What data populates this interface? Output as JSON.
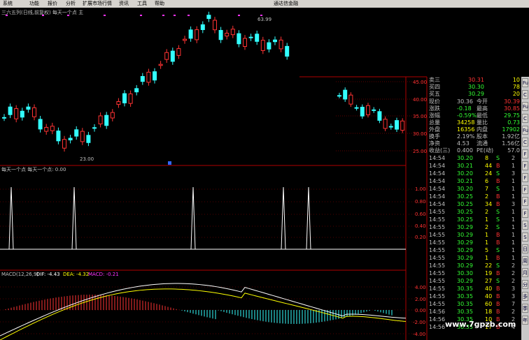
{
  "menu": {
    "items": [
      "系统",
      "功能",
      "报价",
      "分析",
      "扩展市场行情",
      "资讯",
      "工具",
      "帮助"
    ],
    "brand": "通达信金融"
  },
  "main_chart": {
    "title": "三六五列(日线,前复权) 每天一个点 主",
    "high_label": "63.99",
    "low_label": "23.00",
    "price_ticks": [
      "45.00",
      "40.00",
      "35.00",
      "30.00",
      "25.00"
    ]
  },
  "indicator1": {
    "title": "每天一个点  每天一个点: 0.00",
    "ticks": [
      "1.00",
      "0.80",
      "0.60",
      "0.40",
      "0.20"
    ]
  },
  "macd": {
    "label": "MACD(12,26,9)",
    "dif": "DIF: -4.43",
    "dea": "DEA: -4.32",
    "macd": "MACD: -0.21",
    "ticks": [
      "4.00",
      "2.00",
      "0.00",
      "-2.00",
      "-4.00"
    ]
  },
  "quote": {
    "rows": [
      {
        "label": "卖三",
        "value": "30.31",
        "vol": "10"
      },
      {
        "label": "买四",
        "value": "30.30",
        "vol": "78"
      },
      {
        "label": "买五",
        "value": "30.29",
        "vol": "20"
      }
    ],
    "stats": [
      {
        "l1": "现价",
        "v1": "30.36",
        "l2": "今开",
        "v2": "30.39"
      },
      {
        "l1": "涨跌",
        "v1": "-0.18",
        "l2": "最高",
        "v2": "30.85"
      },
      {
        "l1": "涨幅",
        "v1": "-0.59%",
        "l2": "最低",
        "v2": "29.75"
      },
      {
        "l1": "总量",
        "v1": "34258",
        "l2": "量比",
        "v2": "0.73"
      },
      {
        "l1": "外盘",
        "v1": "16356",
        "l2": "内盘",
        "v2": "17902"
      },
      {
        "l1": "换手",
        "v1": "2.19%",
        "l2": "股本",
        "v2": "1.92亿"
      },
      {
        "l1": "净资",
        "v1": "4.53",
        "l2": "流通",
        "v2": "1.56亿"
      },
      {
        "l1": "收益(三)",
        "v1": "0.400",
        "l2": "PE(动)",
        "v2": "57.0"
      }
    ],
    "ticks": [
      {
        "t": "14:54",
        "p": "30.20",
        "v": "8",
        "d": "S",
        "n": "2"
      },
      {
        "t": "14:54",
        "p": "30.21",
        "v": "44",
        "d": "B",
        "n": "1"
      },
      {
        "t": "14:54",
        "p": "30.20",
        "v": "24",
        "d": "S",
        "n": "3"
      },
      {
        "t": "14:54",
        "p": "30.21",
        "v": "6",
        "d": "B",
        "n": "1"
      },
      {
        "t": "14:54",
        "p": "30.20",
        "v": "7",
        "d": "S",
        "n": "1"
      },
      {
        "t": "14:54",
        "p": "30.25",
        "v": "2",
        "d": "B",
        "n": "1"
      },
      {
        "t": "14:54",
        "p": "30.25",
        "v": "34",
        "d": "B",
        "n": "3"
      },
      {
        "t": "14:55",
        "p": "30.25",
        "v": "2",
        "d": "S",
        "n": "1"
      },
      {
        "t": "14:55",
        "p": "30.25",
        "v": "1",
        "d": "S",
        "n": "1"
      },
      {
        "t": "14:55",
        "p": "30.29",
        "v": "2",
        "d": "S",
        "n": "1"
      },
      {
        "t": "14:55",
        "p": "30.29",
        "v": "1",
        "d": "B",
        "n": "1"
      },
      {
        "t": "14:55",
        "p": "30.29",
        "v": "1",
        "d": "B",
        "n": "1"
      },
      {
        "t": "14:55",
        "p": "30.29",
        "v": "5",
        "d": "S",
        "n": "1"
      },
      {
        "t": "14:55",
        "p": "30.29",
        "v": "1",
        "d": "B",
        "n": "1"
      },
      {
        "t": "14:55",
        "p": "30.29",
        "v": "22",
        "d": "S",
        "n": "2"
      },
      {
        "t": "14:55",
        "p": "30.30",
        "v": "19",
        "d": "B",
        "n": "2"
      },
      {
        "t": "14:55",
        "p": "30.29",
        "v": "27",
        "d": "S",
        "n": "2"
      },
      {
        "t": "14:55",
        "p": "30.35",
        "v": "40",
        "d": "B",
        "n": "3"
      },
      {
        "t": "14:55",
        "p": "30.35",
        "v": "40",
        "d": "B",
        "n": "3"
      },
      {
        "t": "14:55",
        "p": "30.35",
        "v": "60",
        "d": "B",
        "n": "7"
      },
      {
        "t": "14:56",
        "p": "30.35",
        "v": "18",
        "d": "B",
        "n": "2"
      },
      {
        "t": "14:56",
        "p": "30.35",
        "v": "10",
        "d": "B",
        "n": "2"
      },
      {
        "t": "14:56",
        "p": "30.35",
        "v": "17",
        "d": "B",
        "n": "4"
      }
    ]
  },
  "side_tabs": [
    "Fu",
    "C",
    "Fu",
    "C",
    "Fu",
    "C",
    "F",
    "F",
    "F",
    "F",
    "F",
    "F",
    "S",
    "S",
    "日",
    "周",
    "月",
    "分",
    "多",
    "季",
    "年"
  ],
  "watermark": "www.7gpzb.com",
  "colors": {
    "up": "#ff3333",
    "down": "#33ffff",
    "yellow": "#ffff00",
    "magenta": "#ff33ff",
    "white": "#ffffff"
  }
}
